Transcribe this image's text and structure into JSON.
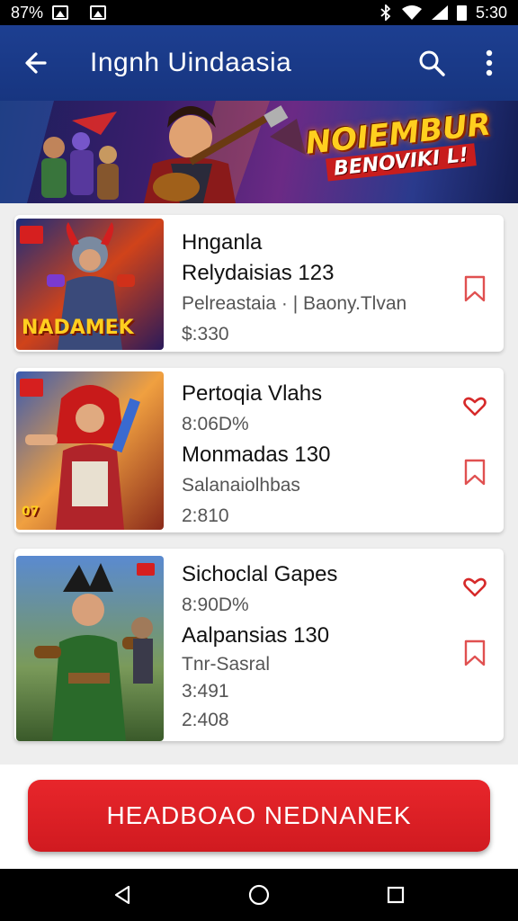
{
  "status_bar": {
    "left_text": "87%",
    "time": "5:30",
    "icons": [
      "image-icon",
      "image-icon",
      "bluetooth-icon",
      "wifi-icon",
      "signal-icon",
      "battery-icon"
    ]
  },
  "app_bar": {
    "title": "Ingnh Uindaasia",
    "back_icon": "arrow-left-icon",
    "search_icon": "search-icon",
    "menu_icon": "more-vert-icon",
    "color": "#1d3f91"
  },
  "banner": {
    "title": "NOIEMBUR",
    "subtitle": "BENOVIKI L!"
  },
  "items": [
    {
      "thumb_logo": "NADAMEK",
      "lines": [
        "Hnganla",
        "Relydaisias 123",
        "Pelreastaia · | Baony.Tlvan",
        "$:330"
      ],
      "actions": [
        "bookmark-icon"
      ]
    },
    {
      "thumb_logo": "07",
      "lines": [
        "Pertoqia Vlahs",
        "8:06D%",
        "Monmadas 130",
        "Salanaiolhbas",
        "2:810"
      ],
      "actions": [
        "heart-icon",
        "bookmark-icon"
      ]
    },
    {
      "thumb_logo": "",
      "lines": [
        "Sichoclal Gapes",
        "8:90D%",
        "Aalpansias 130",
        "Tnr-Sasral",
        "3:491",
        "2:408"
      ],
      "actions": [
        "heart-icon",
        "bookmark-icon"
      ]
    }
  ],
  "footer": {
    "primary_button": "HEADBOAO NEDNANEK",
    "button_color": "#e8262b"
  },
  "nav_bar": {
    "icons": [
      "back-triangle-icon",
      "home-circle-icon",
      "recents-square-icon"
    ]
  }
}
